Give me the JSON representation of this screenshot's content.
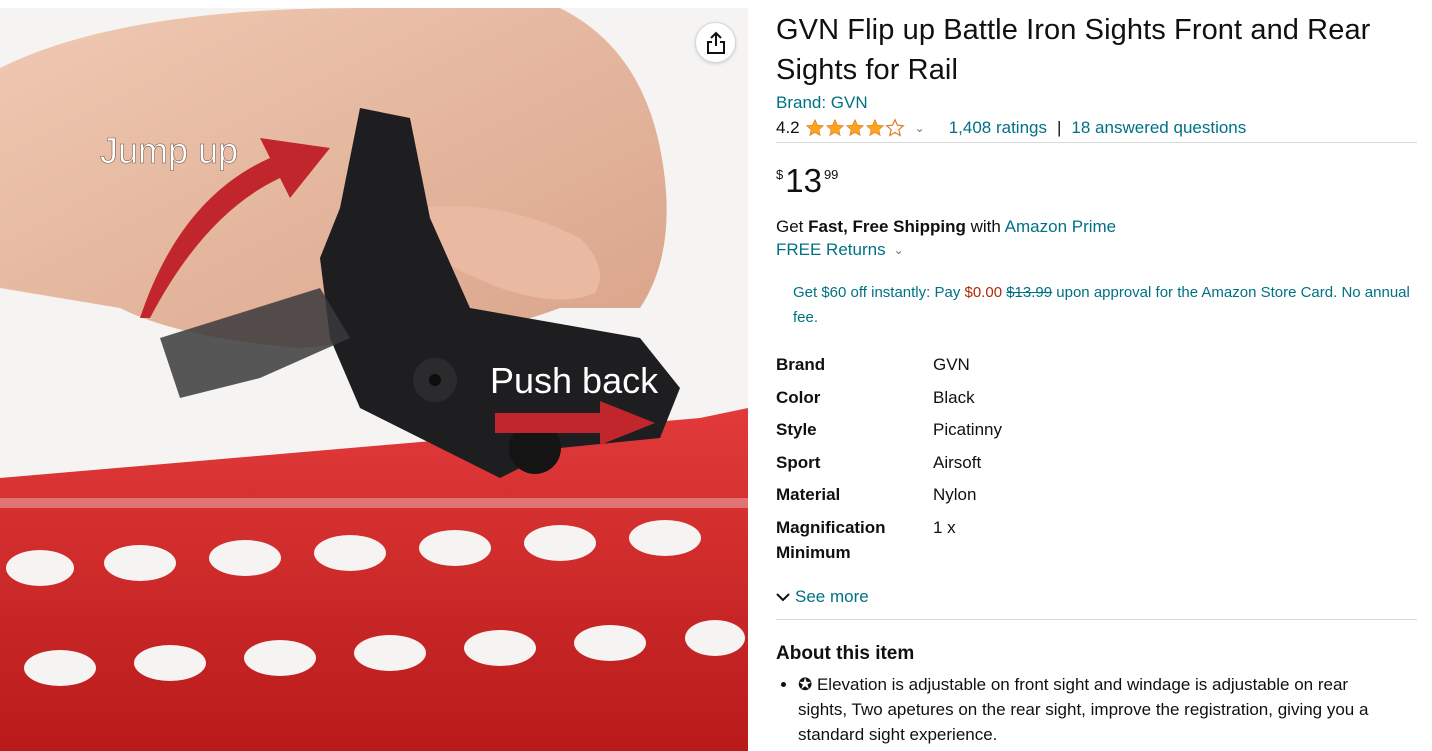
{
  "share": {
    "icon": "share-icon"
  },
  "product": {
    "title": "GVN Flip up Battle Iron Sights Front and Rear Sights for Rail",
    "brand_link": "Brand: GVN"
  },
  "rating": {
    "value": "4.2",
    "stars": 4.2,
    "count_text": "1,408 ratings",
    "separator": "|",
    "questions_text": "18 answered questions"
  },
  "price": {
    "symbol": "$",
    "whole": "13",
    "fraction": "99"
  },
  "shipping": {
    "prefix": "Get",
    "bold": "Fast, Free Shipping",
    "middle": "with",
    "prime_link": "Amazon Prime",
    "returns": "FREE Returns"
  },
  "promo": {
    "part1": "Get $60 off instantly: Pay",
    "new_price": "$0.00",
    "old_price": "$13.99",
    "part2": "upon approval for the Amazon Store Card. No annual fee."
  },
  "specs": [
    {
      "key": "Brand",
      "value": "GVN"
    },
    {
      "key": "Color",
      "value": "Black"
    },
    {
      "key": "Style",
      "value": "Picatinny"
    },
    {
      "key": "Sport",
      "value": "Airsoft"
    },
    {
      "key": "Material",
      "value": "Nylon"
    },
    {
      "key": "Magnification Minimum",
      "value": "1 x"
    }
  ],
  "see_more": "See more",
  "about": {
    "title": "About this item",
    "bullets": [
      "✪ Elevation is adjustable on front sight and windage is adjustable on rear sights, Two apetures on the rear sight, improve the registration, giving you a standard sight experience."
    ]
  },
  "image_text": {
    "jump": "Jump up",
    "push": "Push back"
  },
  "colors": {
    "link": "#007185",
    "star": "#ffa41c",
    "rail": "#d42a2a",
    "price_red": "#b12704"
  }
}
